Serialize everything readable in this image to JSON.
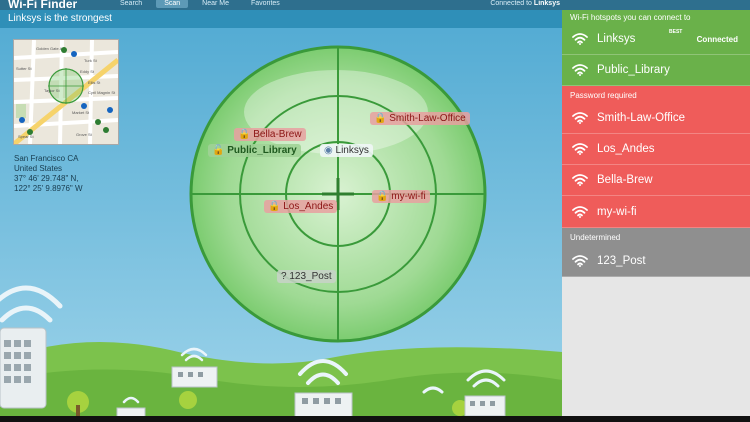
{
  "app": {
    "title": "Wi-Fi Finder"
  },
  "nav": {
    "tabs": [
      {
        "label": "Search"
      },
      {
        "label": "Scan"
      },
      {
        "label": "Near Me"
      },
      {
        "label": "Favorites"
      }
    ],
    "active_index": 1
  },
  "connection": {
    "prefix": "Connected to",
    "network": "Linksys"
  },
  "status": {
    "strongest": "Linksys is the strongest"
  },
  "location": {
    "city": "San Francisco CA",
    "country": "United States",
    "lat": "37° 46' 29.748\" N,",
    "lon": "122° 25' 9.8976\" W"
  },
  "map": {
    "streets": [
      "Turk St",
      "Eddy St",
      "Golden Gate Ave",
      "Ellis St",
      "Market St",
      "Sutter St",
      "Taylor St",
      "Cyril Magnin St",
      "Grove St",
      "Spear St"
    ]
  },
  "radar": {
    "networks": [
      {
        "name": "Bella-Brew",
        "kind": "locked"
      },
      {
        "name": "Public_Library",
        "kind": "open"
      },
      {
        "name": "Linksys",
        "kind": "connected"
      },
      {
        "name": "Smith-Law-Office",
        "kind": "locked"
      },
      {
        "name": "Los_Andes",
        "kind": "locked"
      },
      {
        "name": "my-wi-fi",
        "kind": "locked"
      },
      {
        "name": "123_Post",
        "kind": "unknown"
      }
    ]
  },
  "panel": {
    "open_header": "Wi-Fi hotspots you can connect to",
    "open": [
      {
        "name": "Linksys",
        "badge": "BEST",
        "status": "Connected"
      },
      {
        "name": "Public_Library"
      }
    ],
    "password_header": "Password required",
    "password": [
      {
        "name": "Smith-Law-Office"
      },
      {
        "name": "Los_Andes"
      },
      {
        "name": "Bella-Brew"
      },
      {
        "name": "my-wi-fi"
      }
    ],
    "undetermined_header": "Undetermined",
    "undetermined": [
      {
        "name": "123_Post"
      }
    ]
  },
  "colors": {
    "sky": "#5fb6d8",
    "open": "#6ab14a",
    "locked": "#ef5c5a",
    "undetermined": "#8f8f8f",
    "radar": "#3a9a3a"
  }
}
